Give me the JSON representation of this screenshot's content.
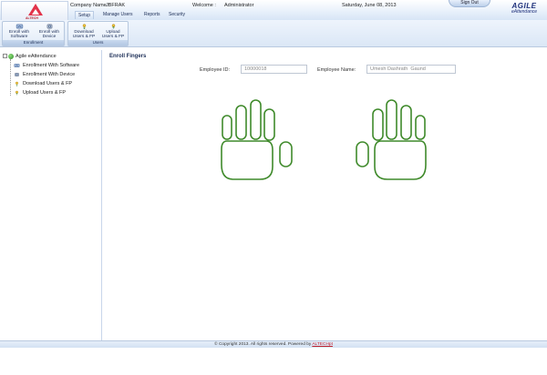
{
  "header": {
    "company_label": "Company Name :",
    "company_value": "JBFRAK",
    "welcome_label": "Welcome :",
    "welcome_value": "Administrator",
    "date": "Saturday, June 08, 2013",
    "signout_label": "Sign Out",
    "logo_text": "ALTECH",
    "brand_name": "AGILE",
    "brand_sub": "eAttendance"
  },
  "menu": {
    "tabs": [
      {
        "label": "Setup",
        "active": true
      },
      {
        "label": "Manage Users",
        "active": false
      },
      {
        "label": "Reports",
        "active": false
      },
      {
        "label": "Security",
        "active": false
      }
    ]
  },
  "ribbon": {
    "groups": [
      {
        "label": "Enrollment",
        "buttons": [
          {
            "line1": "Enroll with",
            "line2": "Software",
            "icon": "fingerprint-software-icon"
          },
          {
            "line1": "Enroll with",
            "line2": "Device",
            "icon": "fingerprint-device-icon"
          }
        ]
      },
      {
        "label": "Users",
        "buttons": [
          {
            "line1": "Download",
            "line2": "Users & FP",
            "icon": "download-users-icon"
          },
          {
            "line1": "Upload",
            "line2": "Users & FP",
            "icon": "upload-users-icon"
          }
        ]
      }
    ]
  },
  "tree": {
    "root": "Agile eAttendance",
    "items": [
      {
        "label": "Enrollment With Software",
        "icon": "fingerprint-software-icon"
      },
      {
        "label": "Enrollment With Device",
        "icon": "fingerprint-device-icon"
      },
      {
        "label": "Download Users & FP",
        "icon": "download-users-icon"
      },
      {
        "label": "Upload Users & FP",
        "icon": "upload-users-icon"
      }
    ]
  },
  "main": {
    "title": "Enroll Fingers",
    "employee_id_label": "Employee ID:",
    "employee_id_value": "10000018",
    "employee_name_label": "Employee Name:",
    "employee_name_value": "Umesh Dashrath  Gaund"
  },
  "footer": {
    "text": "© Copyright 2013. All rights reserved. Powered by ",
    "link": "ALTECHpt"
  },
  "colors": {
    "hand_outline": "#3f8a2b",
    "brand": "#1d2f7a",
    "logo": "#e2334a",
    "link": "#c0202e"
  }
}
